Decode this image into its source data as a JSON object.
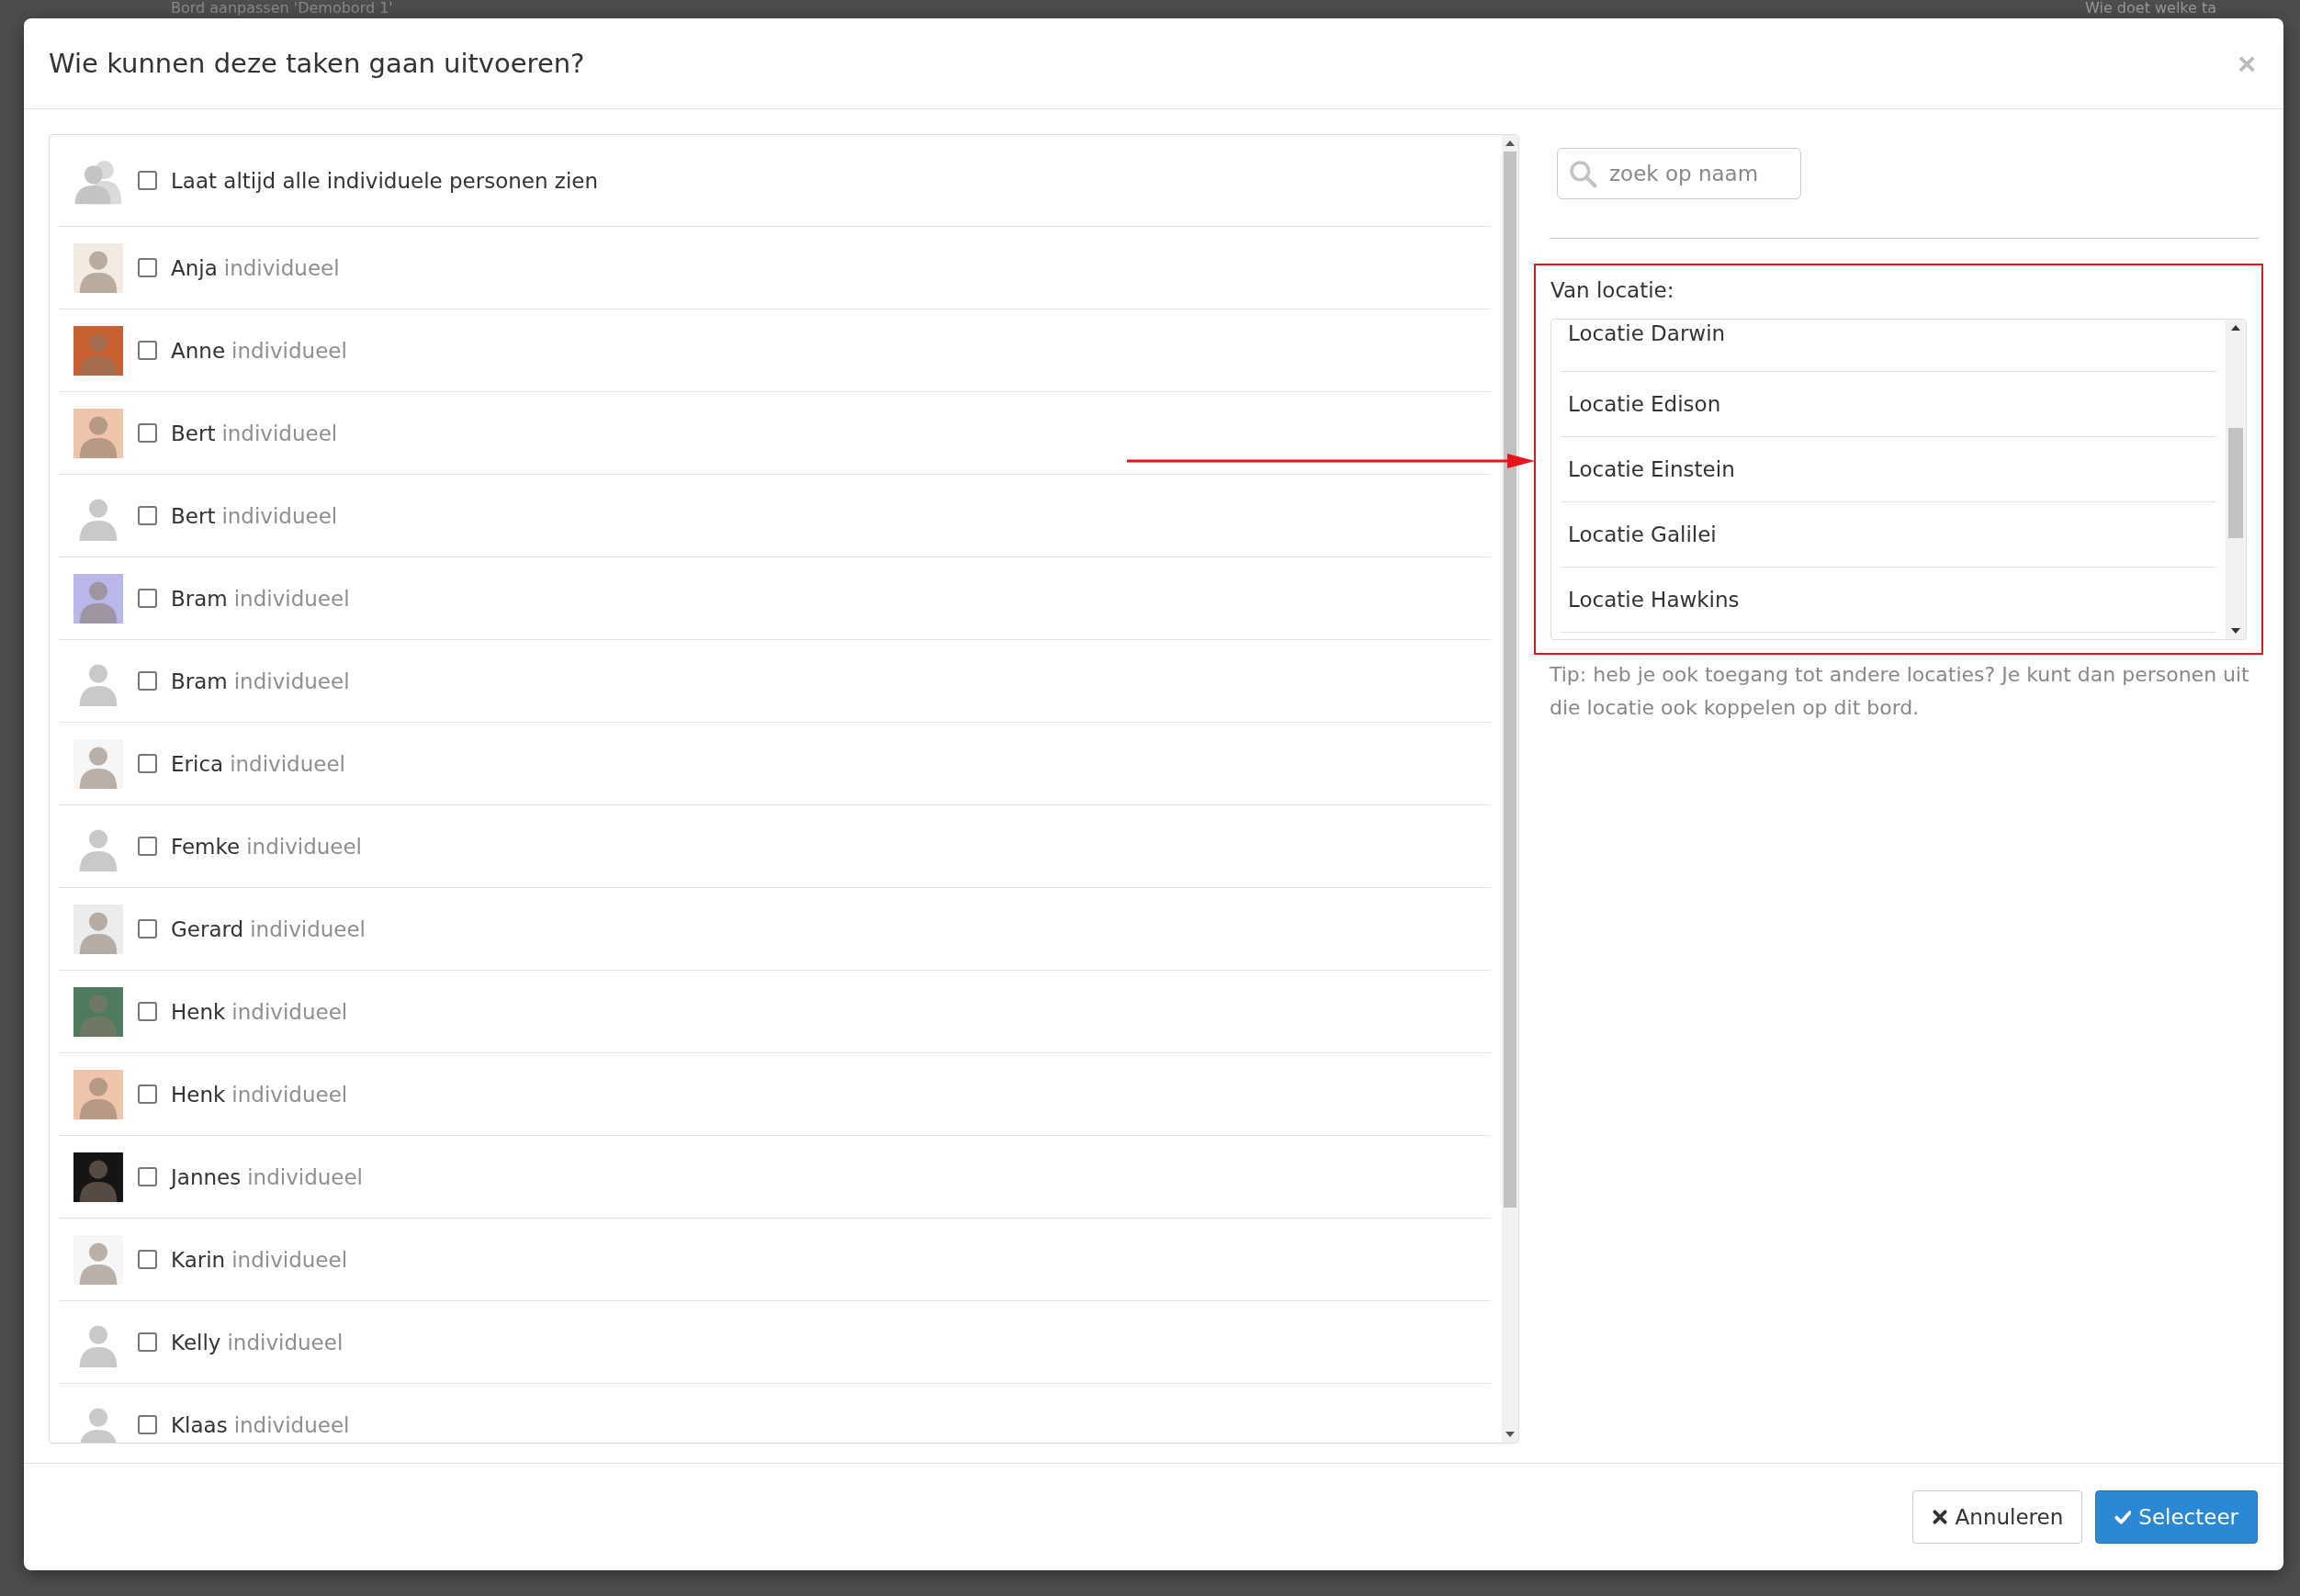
{
  "background": {
    "page_title": "Bord aanpassen 'Demobord 1'",
    "side_title": "Wie doet welke ta"
  },
  "modal": {
    "title": "Wie kunnen deze taken gaan uitvoeren?",
    "close": "×"
  },
  "people": {
    "show_all": {
      "label": "Laat altijd alle individuele personen zien",
      "checked": false
    },
    "rows": [
      {
        "name": "Anja",
        "type": "individueel",
        "checked": false,
        "kind": "photo",
        "color": "#f3ebe1"
      },
      {
        "name": "Anne",
        "type": "individueel",
        "checked": false,
        "kind": "photo",
        "color": "#c8602f"
      },
      {
        "name": "Bert",
        "type": "individueel",
        "checked": false,
        "kind": "photo",
        "color": "#efc4aa"
      },
      {
        "name": "Bert",
        "type": "individueel",
        "checked": false,
        "kind": "silhouette"
      },
      {
        "name": "Bram",
        "type": "individueel",
        "checked": false,
        "kind": "photo",
        "color": "#b9b7ea"
      },
      {
        "name": "Bram",
        "type": "individueel",
        "checked": false,
        "kind": "silhouette"
      },
      {
        "name": "Erica",
        "type": "individueel",
        "checked": false,
        "kind": "photo",
        "color": "#f6f6f6"
      },
      {
        "name": "Femke",
        "type": "individueel",
        "checked": false,
        "kind": "silhouette"
      },
      {
        "name": "Gerard",
        "type": "individueel",
        "checked": false,
        "kind": "photo",
        "color": "#ececec"
      },
      {
        "name": "Henk",
        "type": "individueel",
        "checked": false,
        "kind": "photo",
        "color": "#4f7a5e"
      },
      {
        "name": "Henk",
        "type": "individueel",
        "checked": false,
        "kind": "photo",
        "color": "#efc4aa"
      },
      {
        "name": "Jannes",
        "type": "individueel",
        "checked": false,
        "kind": "photo",
        "color": "#151515"
      },
      {
        "name": "Karin",
        "type": "individueel",
        "checked": false,
        "kind": "photo",
        "color": "#f6f6f6"
      },
      {
        "name": "Kelly",
        "type": "individueel",
        "checked": false,
        "kind": "silhouette"
      },
      {
        "name": "Klaas",
        "type": "individueel",
        "checked": false,
        "kind": "silhouette"
      }
    ]
  },
  "search": {
    "placeholder": "zoek op naam"
  },
  "locations": {
    "label": "Van locatie:",
    "items": [
      {
        "label": "Locatie Darwin",
        "selected": false
      },
      {
        "label": "Locatie Edison",
        "selected": false
      },
      {
        "label": "Locatie Einstein",
        "selected": false
      },
      {
        "label": "Locatie Galilei",
        "selected": false
      },
      {
        "label": "Locatie Hawkins",
        "selected": false
      }
    ]
  },
  "tip": "Tip: heb je ook toegang tot andere locaties? Je kunt dan personen uit die locatie ook koppelen op dit bord.",
  "buttons": [
    {
      "label": "Annuleren",
      "kind": "cancel"
    },
    {
      "label": "Selecteer",
      "kind": "primary"
    }
  ]
}
